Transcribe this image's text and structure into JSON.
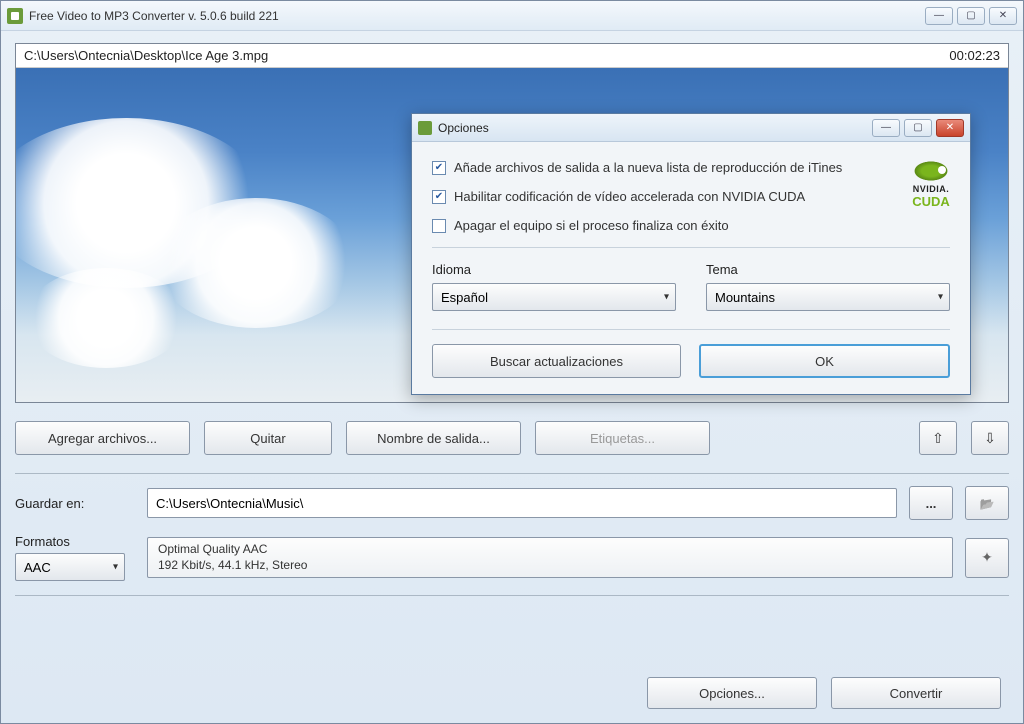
{
  "window": {
    "title": "Free Video to MP3 Converter  v. 5.0.6 build 221"
  },
  "preview": {
    "path": "C:\\Users\\Ontecnia\\Desktop\\Ice Age 3.mpg",
    "duration": "00:02:23"
  },
  "buttons": {
    "add": "Agregar archivos...",
    "remove": "Quitar",
    "output_name": "Nombre de salida...",
    "tags": "Etiquetas..."
  },
  "save": {
    "label": "Guardar en:",
    "path": "C:\\Users\\Ontecnia\\Music\\"
  },
  "formats": {
    "label": "Formatos",
    "selected": "AAC",
    "quality_line1": "Optimal Quality AAC",
    "quality_line2": "192 Kbit/s, 44.1 kHz, Stereo"
  },
  "footer": {
    "options": "Opciones...",
    "convert": "Convertir"
  },
  "dialog": {
    "title": "Opciones",
    "chk1": "Añade archivos de salida a la nueva lista de reproducción de iTines",
    "chk2": "Habilitar codificación de vídeo accelerada con NVIDIA CUDA",
    "chk3": "Apagar el equipo si el proceso finaliza con éxito",
    "lang_label": "Idioma",
    "lang_value": "Español",
    "theme_label": "Tema",
    "theme_value": "Mountains",
    "updates": "Buscar actualizaciones",
    "ok": "OK",
    "cuda_brand": "NVIDIA.",
    "cuda_text": "CUDA"
  }
}
